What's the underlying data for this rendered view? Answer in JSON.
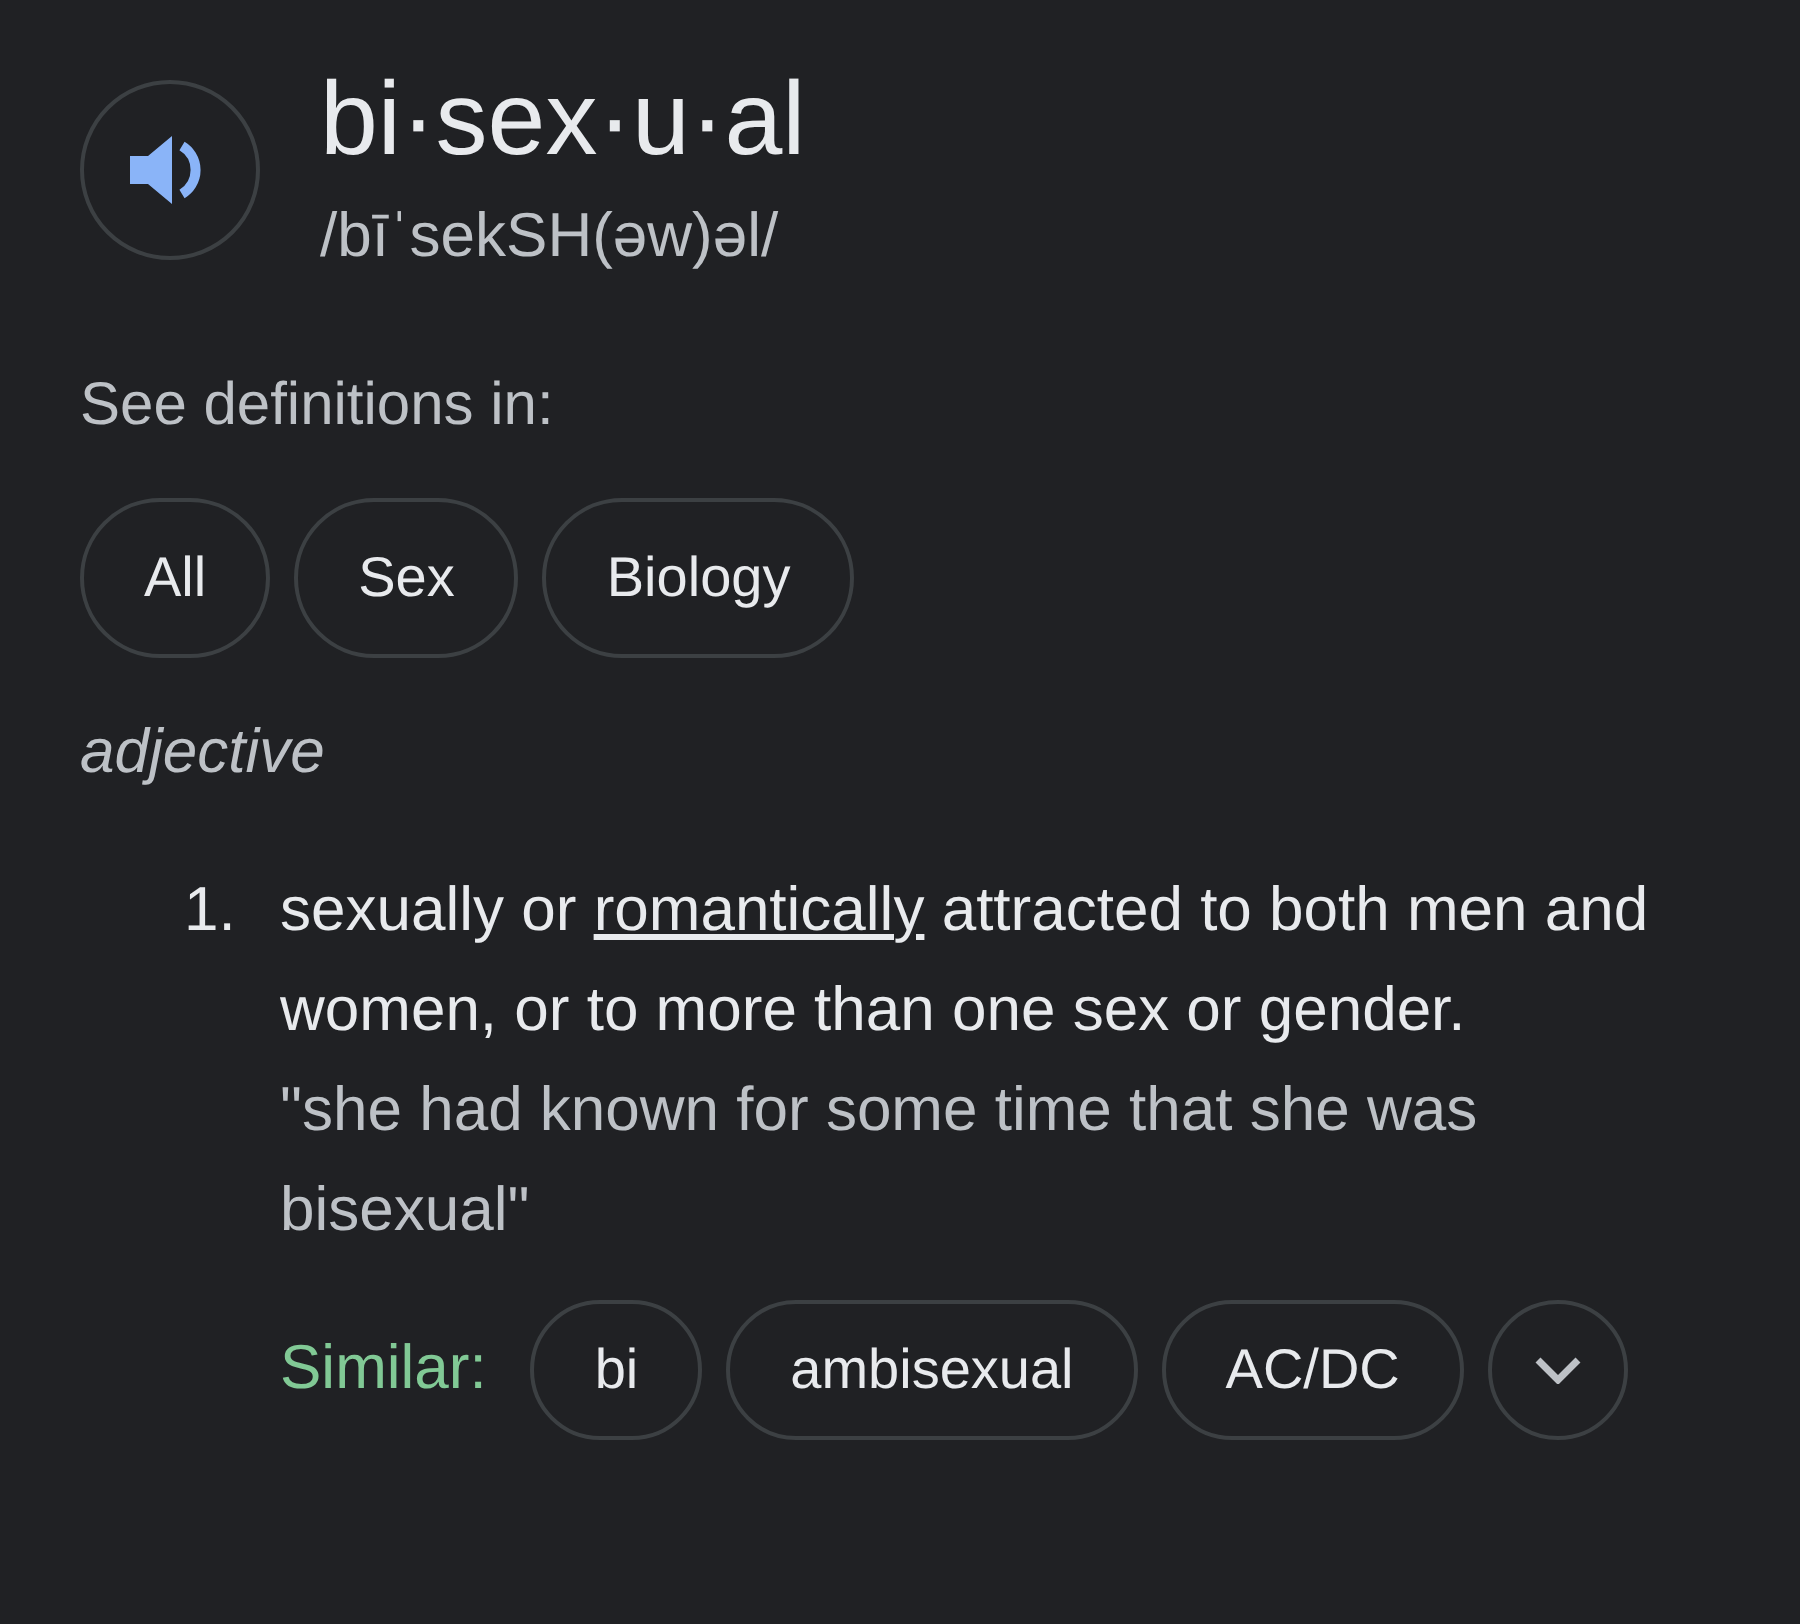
{
  "headword": "bi·sex·u·al",
  "pronunciation": "/bīˈsekSH(əw)əl/",
  "see_definitions_label": "See definitions in:",
  "definition_filters": [
    {
      "label": "All"
    },
    {
      "label": "Sex"
    },
    {
      "label": "Biology"
    }
  ],
  "part_of_speech": "adjective",
  "senses": [
    {
      "number": "1.",
      "definition_before": "sexually or",
      "definition_link": "romantically",
      "definition_after": "attracted to both men and women, or to more than one sex or gender.",
      "example": "\"she had known for some time that she was bisexual\"",
      "similar_label": "Similar:",
      "similar": [
        "bi",
        "ambisexual",
        "AC/DC"
      ]
    }
  ]
}
